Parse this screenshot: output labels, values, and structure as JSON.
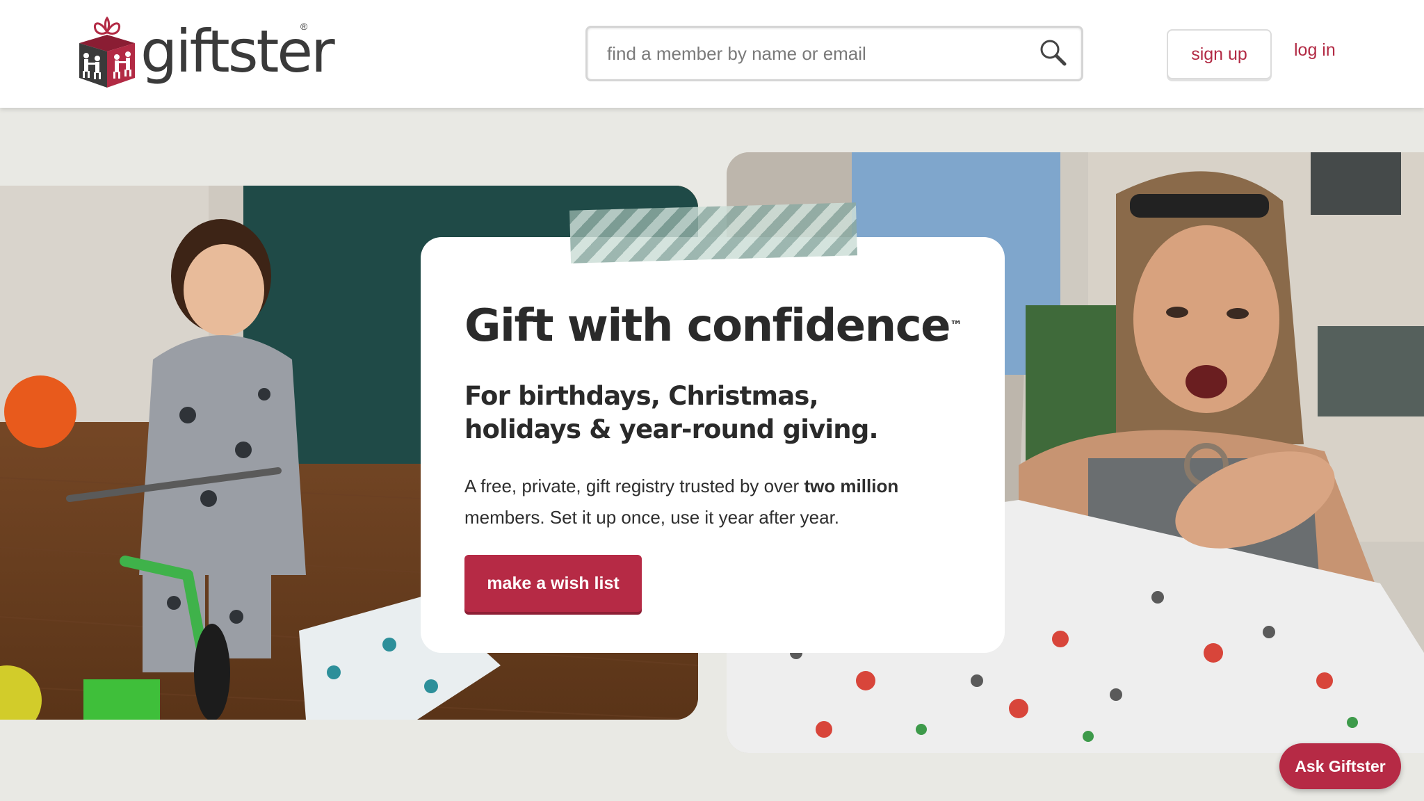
{
  "brand": {
    "name": "giftster",
    "registered_mark": "®",
    "logo_icon": "gift-box-family-logo"
  },
  "header": {
    "search": {
      "placeholder": "find a member by name or email",
      "icon": "search-icon"
    },
    "signup_label": "sign up",
    "login_label": "log in"
  },
  "hero": {
    "headline": "Gift with confidence",
    "trademark": "™",
    "subhead": "For birthdays, Christmas, holidays & year-round giving.",
    "body_prefix": "A free, private, gift registry trusted by over ",
    "body_bold": "two million",
    "body_suffix": " members. Set it up once, use it year after year.",
    "cta_label": "make a wish list"
  },
  "chat": {
    "label": "Ask Giftster"
  },
  "colors": {
    "accent": "#b62a45",
    "page_background": "#e9e9e4",
    "heading_text": "#2a2a2a",
    "tape_stripe": "#8caaa2"
  }
}
